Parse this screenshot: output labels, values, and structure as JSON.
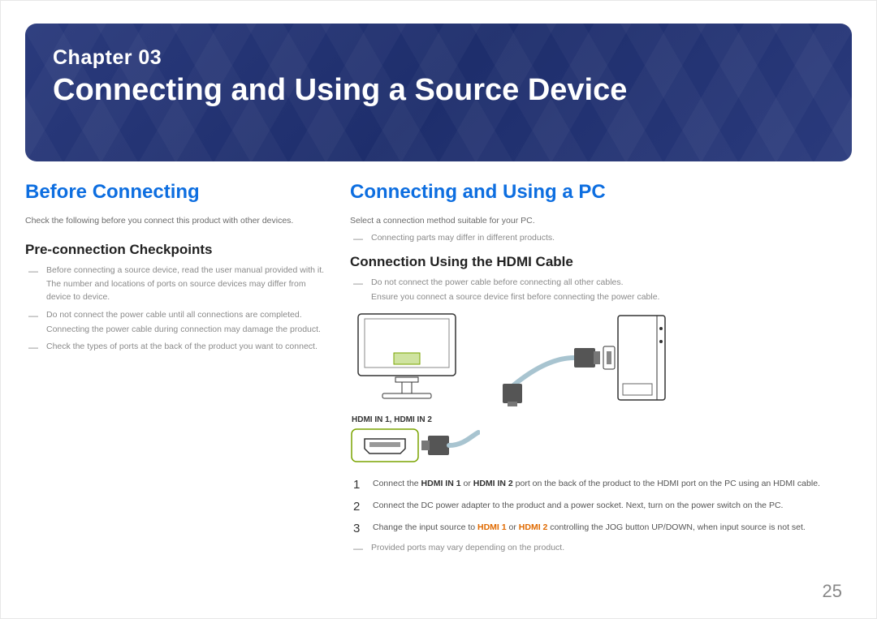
{
  "banner": {
    "chapter_label": "Chapter  03",
    "chapter_title": "Connecting and Using a Source Device"
  },
  "left": {
    "heading": "Before Connecting",
    "intro": "Check the following before you connect this product with other devices.",
    "sub_heading": "Pre-connection Checkpoints",
    "bullets": [
      {
        "main": "Before connecting a source device, read the user manual provided with it.",
        "sub": "The number and locations of ports on source devices may differ from device to device."
      },
      {
        "main": "Do not connect the power cable until all connections are completed.",
        "sub": "Connecting the power cable during connection may damage the product."
      },
      {
        "main": "Check the types of ports at the back of the product you want to connect.",
        "sub": ""
      }
    ]
  },
  "right": {
    "heading": "Connecting and Using a PC",
    "intro": "Select a connection method suitable for your PC.",
    "note1": "Connecting parts may differ in different products.",
    "sub_heading": "Connection Using the HDMI Cable",
    "caution": {
      "main": "Do not connect the power cable before connecting all other cables.",
      "sub": "Ensure you connect a source device first before connecting the power cable."
    },
    "port_label": "HDMI IN 1, HDMI IN 2",
    "steps": [
      {
        "num": "1",
        "pre": "Connect the ",
        "b1": "HDMI IN 1",
        "mid1": " or ",
        "b2": "HDMI IN 2",
        "post": " port on the back of the product to the HDMI port on the PC using an HDMI cable."
      },
      {
        "num": "2",
        "text": "Connect the DC power adapter to the product and a power socket. Next, turn on the power switch on the PC."
      },
      {
        "num": "3",
        "pre": "Change the input source to ",
        "o1": "HDMI 1",
        "mid1": " or ",
        "o2": "HDMI 2",
        "post": " controlling the JOG button UP/DOWN, when input source is not set."
      }
    ],
    "note2": "Provided ports may vary depending on the product."
  },
  "page_number": "25"
}
